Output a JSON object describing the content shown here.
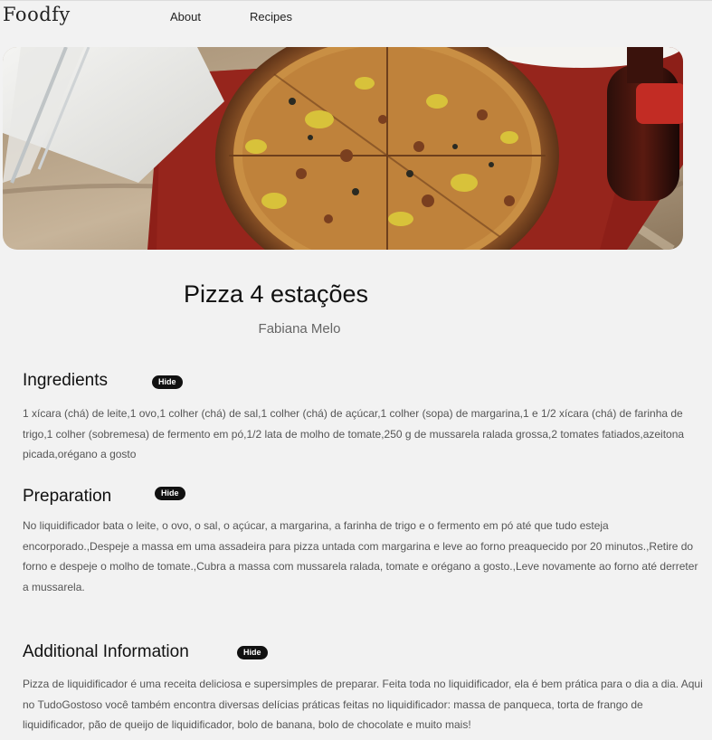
{
  "header": {
    "logo": "Foodfy",
    "nav": {
      "about": "About",
      "recipes": "Recipes"
    }
  },
  "hero": {
    "alt": "pizza-photo"
  },
  "recipe": {
    "title": "Pizza 4 estações",
    "author": "Fabiana Melo"
  },
  "sections": {
    "ingredients": {
      "title": "Ingredients",
      "toggle": "Hide",
      "text": "1 xícara (chá) de leite,1 ovo,1 colher (chá) de sal,1 colher (chá) de açúcar,1 colher (sopa) de margarina,1 e 1/2 xícara (chá) de farinha de trigo,1 colher (sobremesa) de fermento em pó,1/2 lata de molho de tomate,250 g de mussarela ralada grossa,2 tomates fatiados,azeitona picada,orégano a gosto"
    },
    "preparation": {
      "title": "Preparation",
      "toggle": "Hide",
      "text": "No liquidificador bata o leite, o ovo, o sal, o açúcar, a margarina, a farinha de trigo e o fermento em pó até que tudo esteja encorporado.,Despeje a massa em uma assadeira para pizza untada com margarina e leve ao forno preaquecido por 20 minutos.,Retire do forno e despeje o molho de tomate.,Cubra a massa com mussarela ralada, tomate e orégano a gosto.,Leve novamente ao forno até derreter a mussarela."
    },
    "additional": {
      "title": "Additional Information",
      "toggle": "Hide",
      "text": "Pizza de liquidificador é uma receita deliciosa e supersimples de preparar. Feita toda no liquidificador, ela é bem prática para o dia a dia. Aqui no TudoGostoso você também encontra diversas delícias práticas feitas no liquidificador: massa de panqueca, torta de frango de liquidificador, pão de queijo de liquidificador, bolo de banana, bolo de chocolate e muito mais!"
    }
  },
  "colors": {
    "background": "#f2f2f2",
    "button": "#111111",
    "body_text": "#555555"
  }
}
